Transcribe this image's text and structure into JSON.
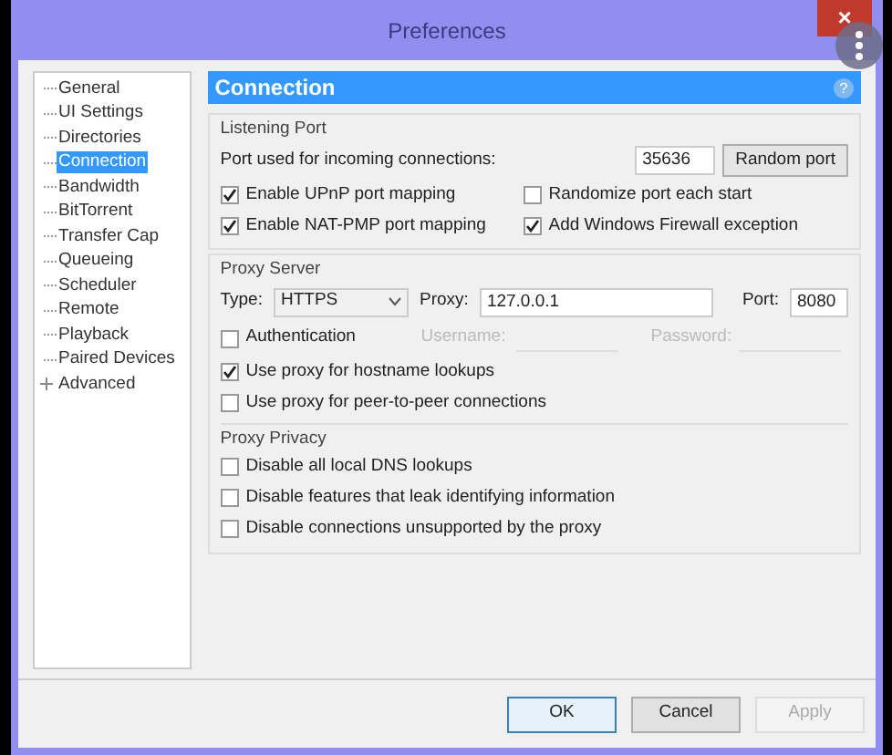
{
  "window": {
    "title": "Preferences",
    "close": "×"
  },
  "sidebar": {
    "items": [
      {
        "label": "General",
        "selected": false
      },
      {
        "label": "UI Settings",
        "selected": false
      },
      {
        "label": "Directories",
        "selected": false
      },
      {
        "label": "Connection",
        "selected": true
      },
      {
        "label": "Bandwidth",
        "selected": false
      },
      {
        "label": "BitTorrent",
        "selected": false
      },
      {
        "label": "Transfer Cap",
        "selected": false
      },
      {
        "label": "Queueing",
        "selected": false
      },
      {
        "label": "Scheduler",
        "selected": false
      },
      {
        "label": "Remote",
        "selected": false
      },
      {
        "label": "Playback",
        "selected": false
      },
      {
        "label": "Paired Devices",
        "selected": false
      },
      {
        "label": "Advanced",
        "selected": false,
        "expandable": true
      }
    ]
  },
  "header": {
    "title": "Connection",
    "help": "?"
  },
  "listening_port": {
    "title": "Listening Port",
    "port_label": "Port used for incoming connections:",
    "port": "35636",
    "random_button": "Random port",
    "options": [
      {
        "label": "Enable UPnP port mapping",
        "checked": true
      },
      {
        "label": "Randomize port each start",
        "checked": false
      },
      {
        "label": "Enable NAT-PMP port mapping",
        "checked": true
      },
      {
        "label": "Add Windows Firewall exception",
        "checked": true
      }
    ]
  },
  "proxy_server": {
    "title": "Proxy Server",
    "type_label": "Type:",
    "type": "HTTPS",
    "proxy_label": "Proxy:",
    "proxy": "127.0.0.1",
    "port_label": "Port:",
    "port": "8080",
    "auth": {
      "label": "Authentication",
      "checked": false,
      "username_label": "Username:",
      "password_label": "Password:"
    },
    "options": [
      {
        "label": "Use proxy for hostname lookups",
        "checked": true
      },
      {
        "label": "Use proxy for peer-to-peer connections",
        "checked": false
      }
    ]
  },
  "proxy_privacy": {
    "title": "Proxy Privacy",
    "options": [
      {
        "label": "Disable all local DNS lookups",
        "checked": false
      },
      {
        "label": "Disable features that leak identifying information",
        "checked": false
      },
      {
        "label": "Disable connections unsupported by the proxy",
        "checked": false
      }
    ]
  },
  "buttons": [
    {
      "label": "OK",
      "kind": "default",
      "disabled": false
    },
    {
      "label": "Cancel",
      "kind": "normal",
      "disabled": false
    },
    {
      "label": "Apply",
      "kind": "normal",
      "disabled": true
    }
  ]
}
